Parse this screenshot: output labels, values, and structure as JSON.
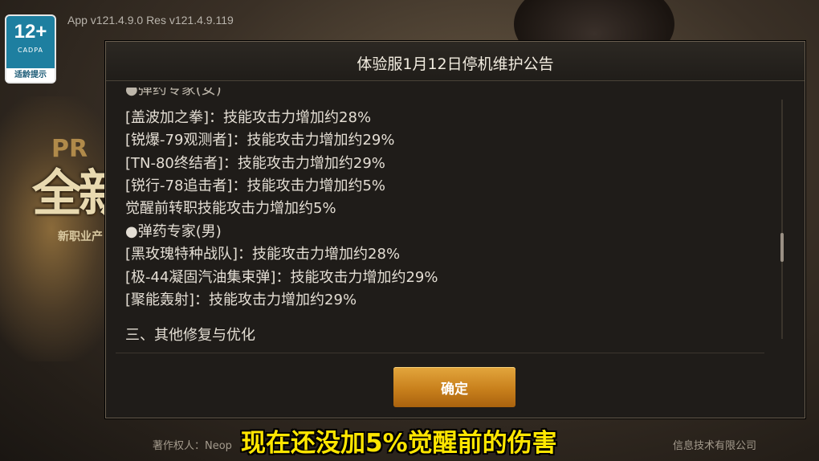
{
  "app": {
    "version": "App v121.4.9.0 Res v121.4.9.119",
    "rating": {
      "age": "12+",
      "org": "CADPA",
      "tip": "适龄提示"
    },
    "background_logo": {
      "prefix": "PR",
      "main": "全新",
      "subtitle": "新职业产"
    }
  },
  "dialog": {
    "title": "体验服1月12日停机维护公告",
    "lines": [
      "[盖波加之拳]：技能攻击力增加约28%",
      "[锐爆-79观测者]：技能攻击力增加约29%",
      "[TN-80终结者]：技能攻击力增加约29%",
      "[锐行-78追击者]：技能攻击力增加约5%",
      "觉醒前转职技能攻击力增加约5%",
      "●弹药专家(男)",
      "[黑玫瑰特种战队]：技能攻击力增加约28%",
      "[极-44凝固汽油集束弹]：技能攻击力增加约29%",
      "[聚能轰射]：技能攻击力增加约29%"
    ],
    "section": "三、其他修复与优化",
    "confirm_label": "确定"
  },
  "footer": {
    "left": "著作权人：Neop",
    "right": "信息技术有限公司"
  },
  "subtitle": "现在还没加5%觉醒前的伤害"
}
